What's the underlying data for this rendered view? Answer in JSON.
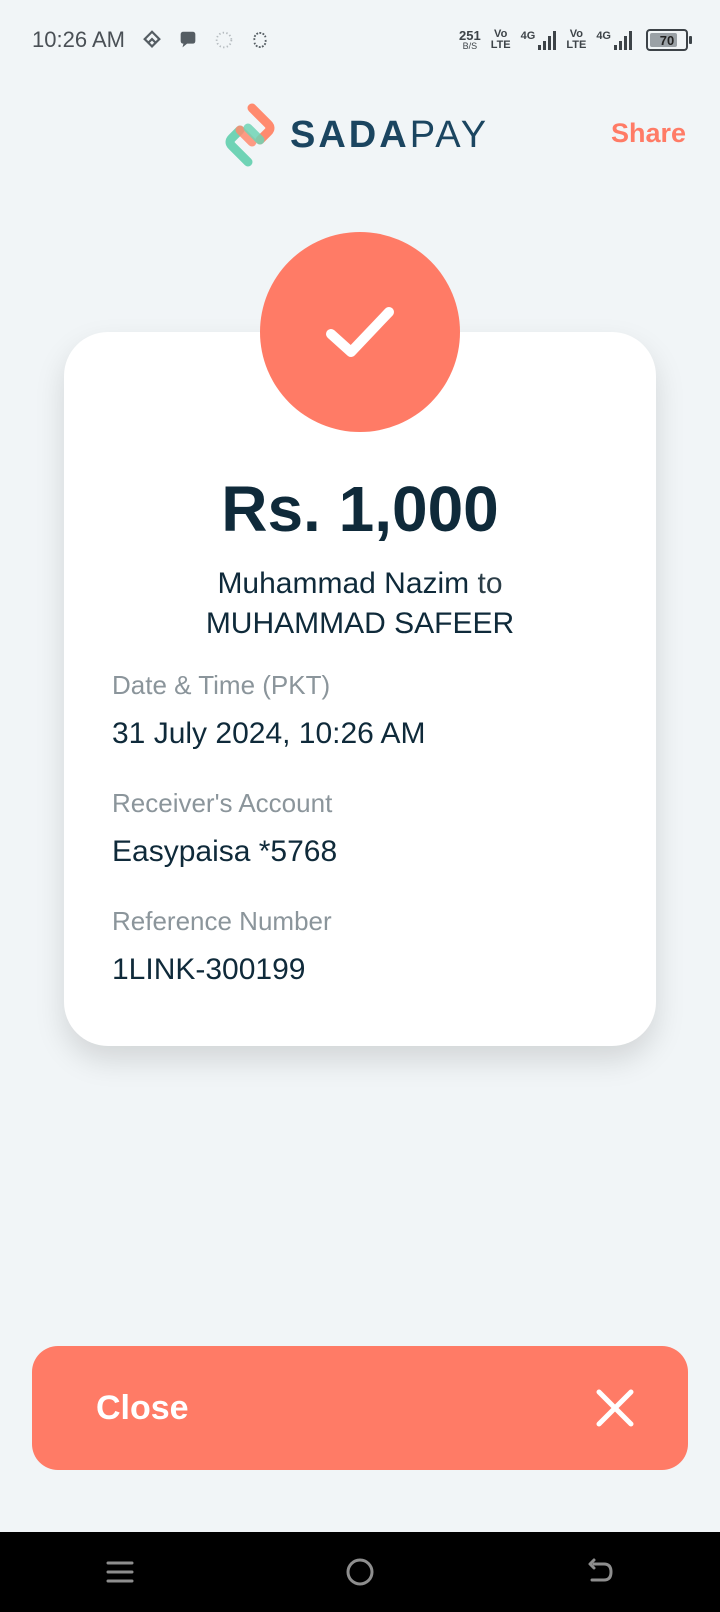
{
  "status_bar": {
    "time": "10:26 AM",
    "net_speed": "251",
    "net_speed_unit": "B/S",
    "volte_1": "Vo",
    "volte_1_sub": "LTE",
    "sig_1": "4G",
    "volte_2": "Vo",
    "volte_2_sub": "LTE",
    "sig_2": "4G",
    "battery_level": "70"
  },
  "header": {
    "brand_name_bold": "SADA",
    "brand_name_light": "PAY",
    "share_label": "Share"
  },
  "receipt": {
    "amount": "Rs. 1,000",
    "sender": "Muhammad Nazim",
    "to_word": "to",
    "receiver": "MUHAMMAD SAFEER",
    "details": [
      {
        "label": "Date & Time (PKT)",
        "value": "31 July 2024, 10:26 AM"
      },
      {
        "label": "Receiver's Account",
        "value": "Easypaisa *5768"
      },
      {
        "label": "Reference Number",
        "value": "1LINK-300199"
      }
    ]
  },
  "footer": {
    "close_label": "Close"
  },
  "colors": {
    "accent": "#ff7b66",
    "brand_text": "#1b4560",
    "background": "#f1f5f7",
    "card": "#ffffff"
  }
}
